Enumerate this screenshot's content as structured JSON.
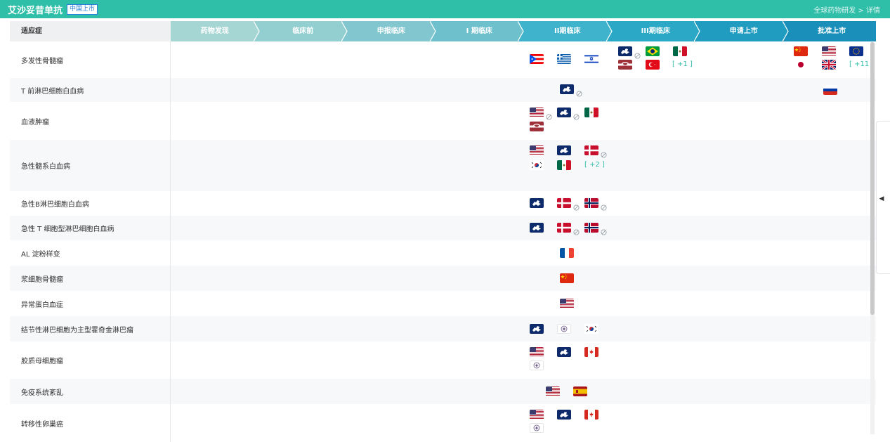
{
  "header": {
    "title": "艾沙妥昔单抗",
    "badge": "中国上市",
    "breadcrumb_link": "全球药物研发",
    "breadcrumb_sep": ">",
    "breadcrumb_current": "详情"
  },
  "table": {
    "indication_header": "适应症",
    "stages": [
      "药物发现",
      "临床前",
      "申报临床",
      "I 期临床",
      "II期临床",
      "III期临床",
      "申请上市",
      "批准上市"
    ],
    "stage_colors": [
      "#a6d6d3",
      "#93cfd0",
      "#82c7cf",
      "#6ec0cd",
      "#3fb3cb",
      "#2aa8c6",
      "#1f9cc0",
      "#1a8fb9"
    ],
    "rows": [
      {
        "label": "多发性骨髓瘤",
        "more_ph3": "[ +1 ]",
        "more_app": "[ +11 ]"
      },
      {
        "label": "T 前淋巴细胞白血病"
      },
      {
        "label": "血液肿瘤"
      },
      {
        "label": "急性髓系白血病",
        "more_ph2": "[ +2 ]"
      },
      {
        "label": "急性B淋巴细胞白血病"
      },
      {
        "label": "急性 T 细胞型淋巴细胞白血病"
      },
      {
        "label": "AL 淀粉样变"
      },
      {
        "label": "浆细胞骨髓瘤"
      },
      {
        "label": "异常蛋白血症"
      },
      {
        "label": "结节性淋巴细胞为主型霍奇金淋巴瘤"
      },
      {
        "label": "胶质母细胞瘤"
      },
      {
        "label": "免疫系统紊乱"
      },
      {
        "label": "转移性卵巢癌"
      }
    ]
  },
  "flag_icons": [
    "puerto-rico-flag-icon",
    "greece-flag-icon",
    "israel-flag-icon",
    "eu-flag-icon",
    "brazil-flag-icon",
    "mexico-flag-icon",
    "latvia-flag-icon",
    "turkey-flag-icon",
    "china-flag-icon",
    "usa-flag-icon",
    "japan-flag-icon",
    "uk-flag-icon",
    "russia-flag-icon",
    "denmark-flag-icon",
    "norway-flag-icon",
    "korea-flag-icon",
    "france-flag-icon",
    "taiwan-flag-icon",
    "canada-flag-icon",
    "spain-flag-icon"
  ]
}
